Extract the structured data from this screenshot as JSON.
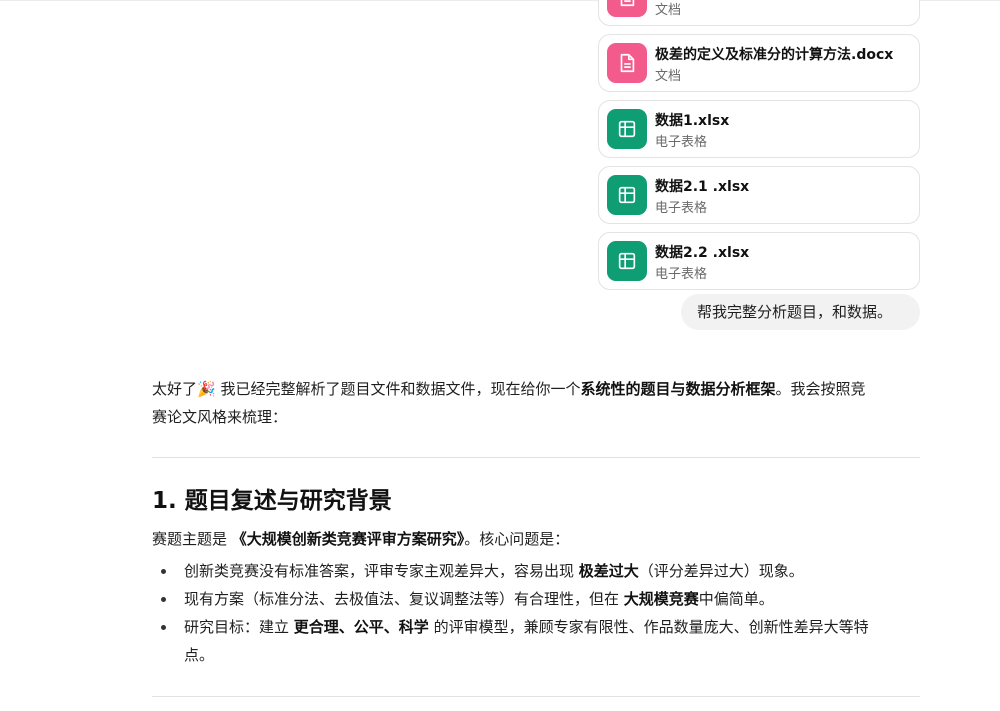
{
  "attachments": [
    {
      "name": "",
      "type": "文档",
      "kind": "doc",
      "color": "#f25b8b"
    },
    {
      "name": "极差的定义及标准分的计算方法.docx",
      "type": "文档",
      "kind": "doc",
      "color": "#f25b8b"
    },
    {
      "name": "数据1.xlsx",
      "type": "电子表格",
      "kind": "sheet",
      "color": "#0f9d73"
    },
    {
      "name": "数据2.1 .xlsx",
      "type": "电子表格",
      "kind": "sheet",
      "color": "#0f9d73"
    },
    {
      "name": "数据2.2 .xlsx",
      "type": "电子表格",
      "kind": "sheet",
      "color": "#0f9d73"
    }
  ],
  "user_message": "帮我完整分析题目，和数据。",
  "answer": {
    "intro": {
      "t1": "太好了",
      "emoji": "🎉",
      "t2": " 我已经完整解析了题目文件和数据文件，现在给你一个",
      "bold": "系统性的题目与数据分析框架",
      "t3": "。我会按照竞",
      "line2": "赛论文风格来梳理："
    },
    "section1": {
      "title": "1. 题目复述与研究背景",
      "para": {
        "t1": "赛题主题是 ",
        "bold": "《大规模创新类竞赛评审方案研究》",
        "t2": "。核心问题是："
      },
      "bullets": [
        {
          "t1": "创新类竞赛没有标准答案，评审专家主观差异大，容易出现 ",
          "bold": "极差过大",
          "t2": "（评分差异过大）现象。",
          "line2": ""
        },
        {
          "t1": "现有方案（标准分法、去极值法、复议调整法等）有合理性，但在 ",
          "bold": "大规模竞赛",
          "t2": "中偏简单。",
          "line2": ""
        },
        {
          "t1": "研究目标：建立 ",
          "bold": "更合理、公平、科学",
          "t2": " 的评审模型，兼顾专家有限性、作品数量庞大、创新性差异大等特",
          "line2": "点。"
        }
      ]
    }
  }
}
